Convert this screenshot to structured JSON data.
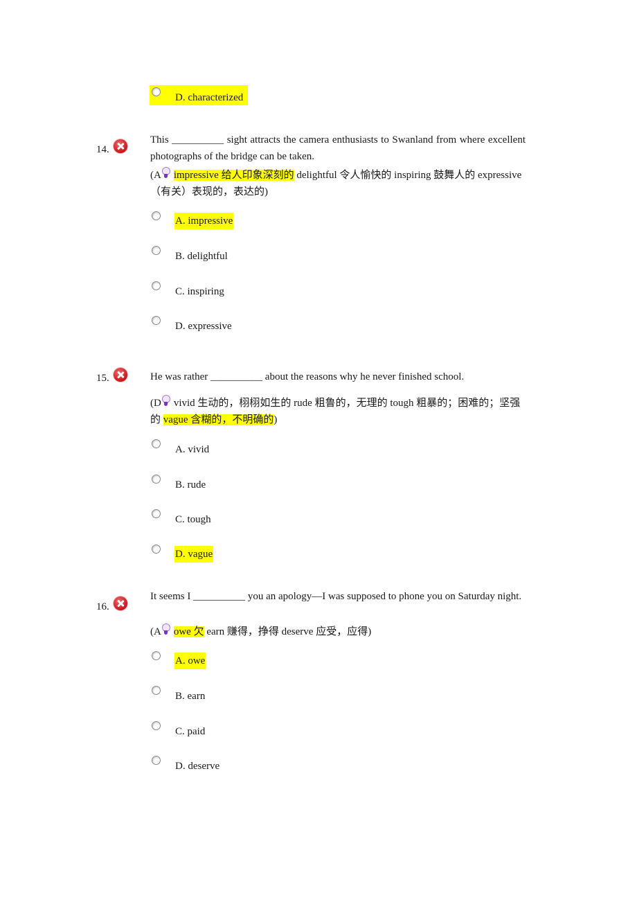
{
  "prev_option": {
    "label": "D. characterized",
    "highlighted": true
  },
  "questions": [
    {
      "number": "14.",
      "status_icon": "wrong-x-icon",
      "text": "This __________ sight attracts the camera enthusiasts to Swanland from where excellent photographs of the bridge can be taken.",
      "hint_prefix": "(A",
      "hint_highlight": "impressive  给人印象深刻的",
      "hint_rest": " delightful  令人愉快的  inspiring  鼓舞人的  expressive  （有关）表现的，表达的)",
      "options": [
        {
          "label": "A. impressive",
          "correct": true
        },
        {
          "label": "B. delightful",
          "correct": false
        },
        {
          "label": "C. inspiring",
          "correct": false
        },
        {
          "label": "D. expressive",
          "correct": false
        }
      ]
    },
    {
      "number": "15.",
      "status_icon": "wrong-x-icon",
      "text": "He was rather __________ about the reasons why he never finished school.",
      "hint_prefix": "(D",
      "hint_pre_highlight": "vivid  生动的，栩栩如生的  rude  粗鲁的，无理的  tough  粗暴的；困难的；坚强的 ",
      "hint_highlight": "vague  含糊的，不明确的",
      "hint_rest": ")",
      "options": [
        {
          "label": "A. vivid",
          "correct": false
        },
        {
          "label": "B. rude",
          "correct": false
        },
        {
          "label": "C. tough",
          "correct": false
        },
        {
          "label": "D. vague",
          "correct": true
        }
      ]
    },
    {
      "number": "16.",
      "status_icon": "wrong-x-icon",
      "text": "It seems I __________ you an apology—I was supposed to phone you on Saturday night.",
      "hint_prefix": "(A",
      "hint_highlight": "owe  欠",
      "hint_rest": " earn  赚得，挣得  deserve  应受，应得)",
      "options": [
        {
          "label": "A. owe",
          "correct": true
        },
        {
          "label": "B. earn",
          "correct": false
        },
        {
          "label": "C. paid",
          "correct": false
        },
        {
          "label": "D. deserve",
          "correct": false
        }
      ]
    }
  ]
}
